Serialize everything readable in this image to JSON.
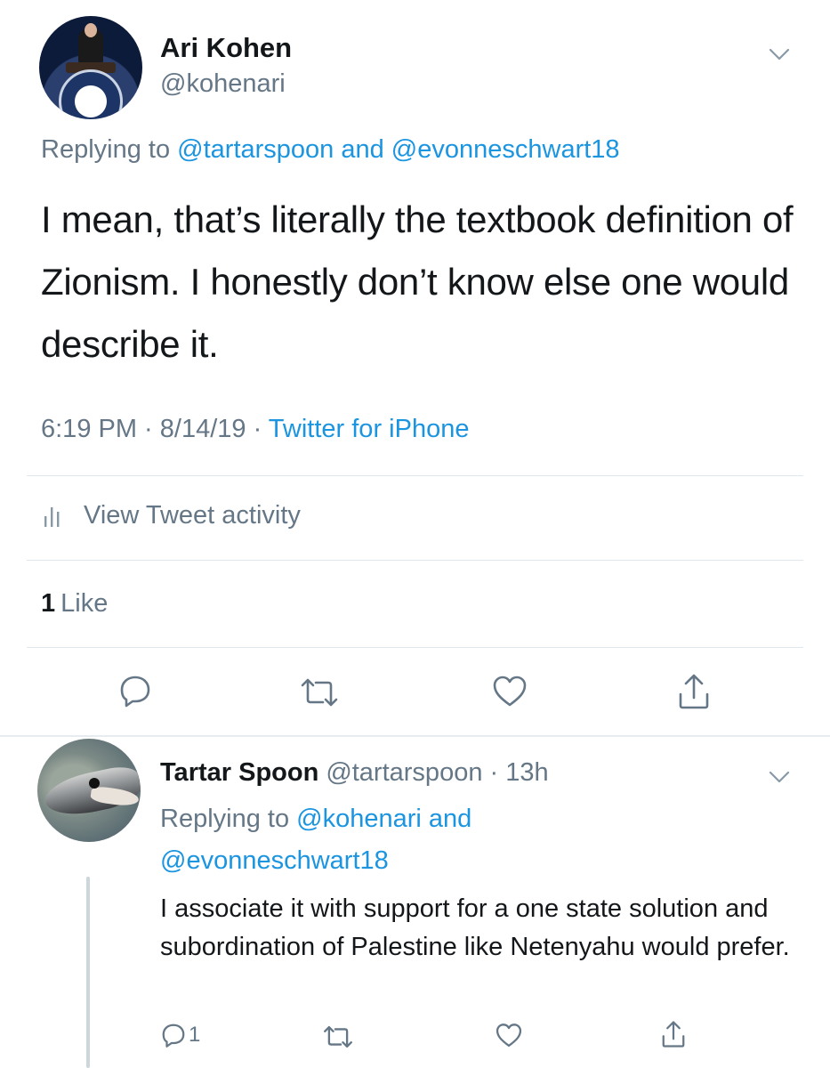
{
  "main_tweet": {
    "author_name": "Ari Kohen",
    "author_handle": "@kohenari",
    "replying_prefix": "Replying to ",
    "replying_to_1": "@tartarspoon",
    "replying_and": " and ",
    "replying_to_2": "@evonneschwart18",
    "text": "I mean, that’s literally the textbook definition of Zionism. I honestly don’t know else one would describe it.",
    "time": "6:19 PM",
    "sep1": " · ",
    "date": "8/14/19",
    "sep2": " · ",
    "source": "Twitter for iPhone",
    "activity_label": "View Tweet activity",
    "likes_count": "1",
    "likes_label": "Like",
    "icons": {
      "caret": "chevron-down-icon",
      "activity": "bar-chart-icon",
      "reply": "reply-icon",
      "retweet": "retweet-icon",
      "like": "heart-icon",
      "share": "share-icon"
    }
  },
  "reply_tweet": {
    "author_name": "Tartar Spoon",
    "author_handle": "@tartarspoon",
    "sep": " · ",
    "age": "13h",
    "replying_prefix": "Replying to ",
    "replying_to_1": "@kohenari",
    "replying_and": " and",
    "replying_to_2": "@evonneschwart18",
    "text": "I associate it with support for a one state solution and subordination of Palestine like Netenyahu would prefer.",
    "reply_count": "1"
  },
  "colors": {
    "text": "#14171a",
    "secondary": "#657786",
    "link": "#1b95e0",
    "divider": "#e1e8ed"
  }
}
